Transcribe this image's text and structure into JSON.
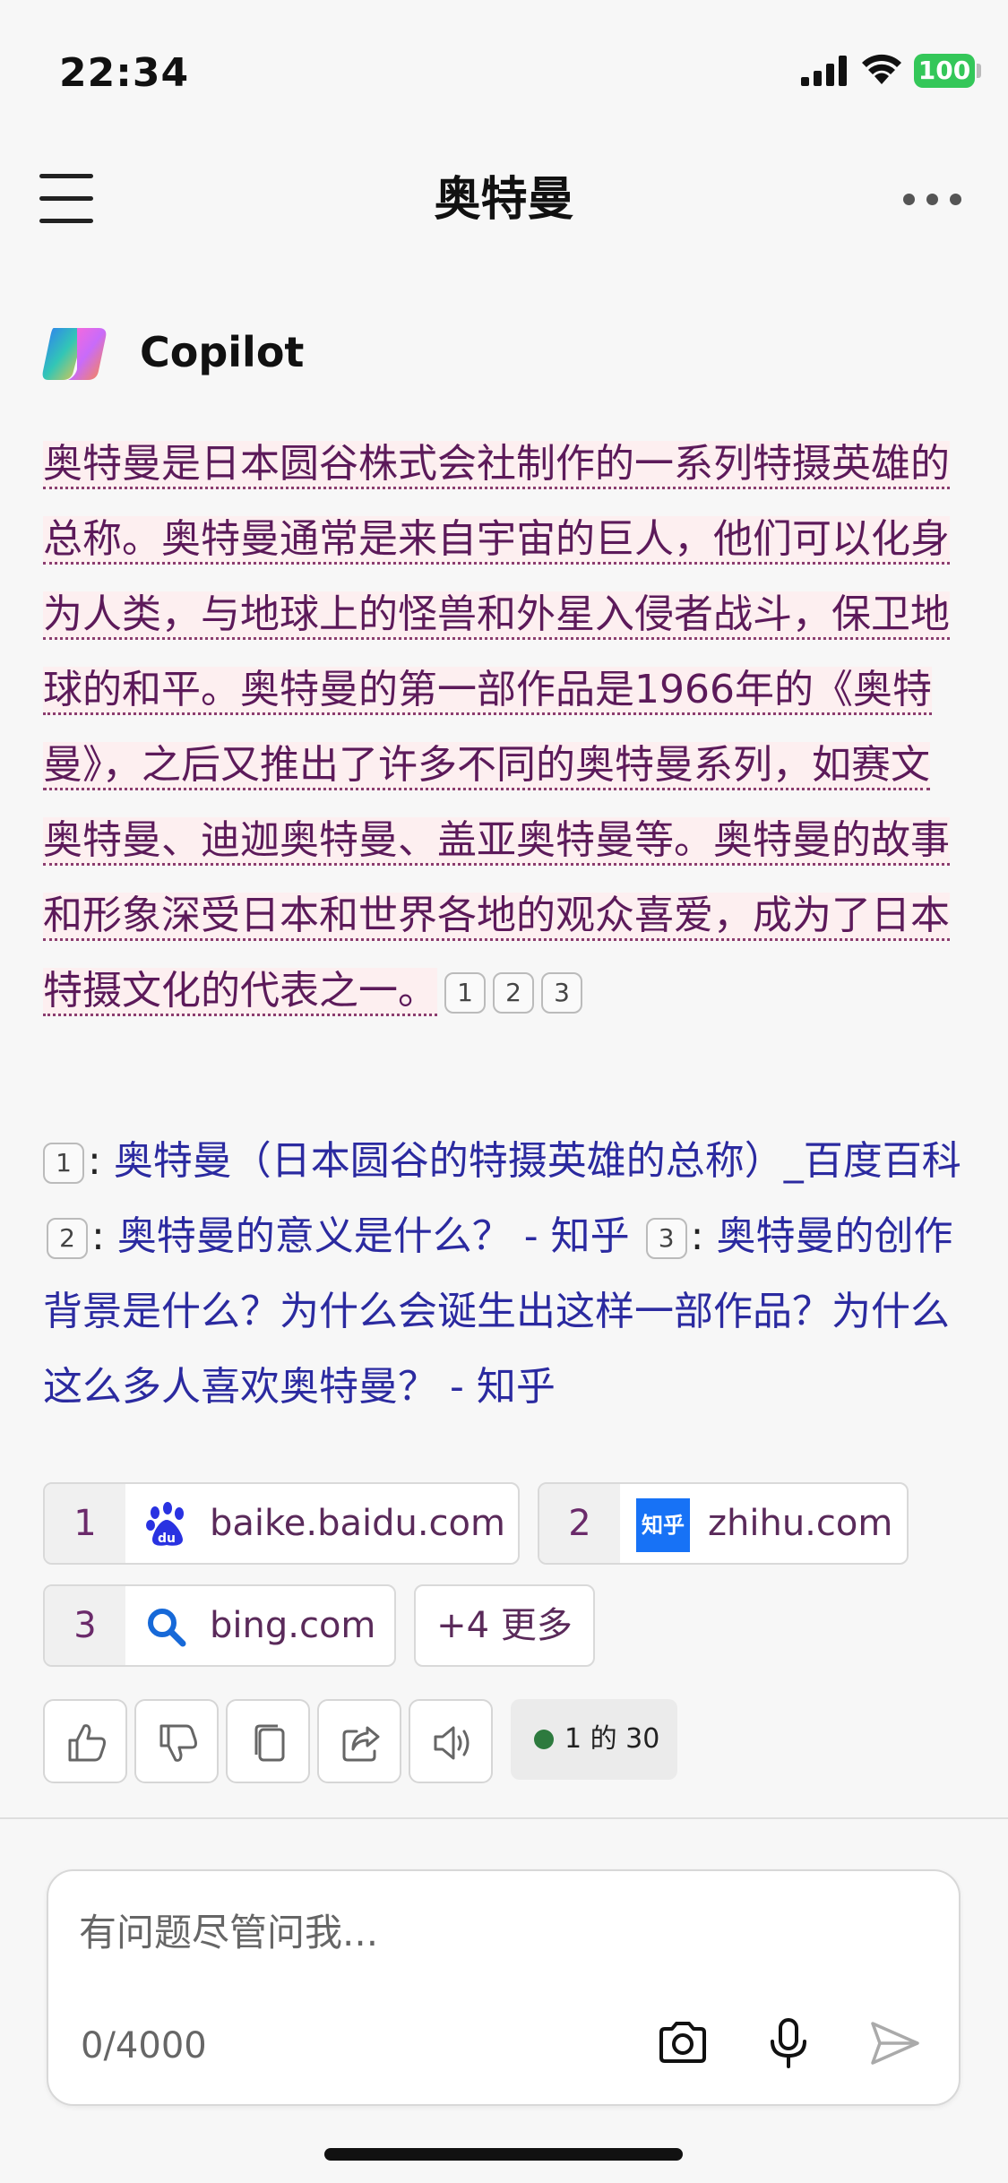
{
  "status": {
    "time": "22:34",
    "battery": "100"
  },
  "header": {
    "title": "奥特曼"
  },
  "assistant": {
    "name": "Copilot"
  },
  "answer": {
    "text": "奥特曼是日本圆谷株式会社制作的一系列特摄英雄的总称。奥特曼通常是来自宇宙的巨人，他们可以化身为人类，与地球上的怪兽和外星入侵者战斗，保卫地球的和平。奥特曼的第一部作品是1966年的《奥特曼》，之后又推出了许多不同的奥特曼系列，如赛文奥特曼、迪迦奥特曼、盖亚奥特曼等。奥特曼的故事和形象深受日本和世界各地的观众喜爱，成为了日本特摄文化的代表之一。",
    "citations": [
      "1",
      "2",
      "3"
    ]
  },
  "references": [
    {
      "num": "1",
      "title": "奥特曼（日本圆谷的特摄英雄的总称）_百度百科"
    },
    {
      "num": "2",
      "title": "奥特曼的意义是什么？ - 知乎"
    },
    {
      "num": "3",
      "title": "奥特曼的创作背景是什么？为什么会诞生出这样一部作品？为什么这么多人喜欢奥特曼？ - 知乎"
    }
  ],
  "sources": [
    {
      "num": "1",
      "domain": "baike.baidu.com",
      "icon": "baidu-paw-icon"
    },
    {
      "num": "2",
      "domain": "zhihu.com",
      "icon": "zhihu-icon",
      "icon_text": "知乎"
    },
    {
      "num": "3",
      "domain": "bing.com",
      "icon": "search-icon"
    }
  ],
  "more_sources": "+4 更多",
  "actions": [
    "thumbs-up-icon",
    "thumbs-down-icon",
    "copy-icon",
    "share-icon",
    "speaker-icon"
  ],
  "counter": "1 的 30",
  "input": {
    "placeholder": "有问题尽管问我...",
    "char_count": "0/4000"
  },
  "colors": {
    "answer_text": "#5c1a5a",
    "link": "#2b2aa0",
    "highlight": "#fdeff0",
    "counter_dot": "#2d7a3e",
    "battery": "#34c759"
  }
}
